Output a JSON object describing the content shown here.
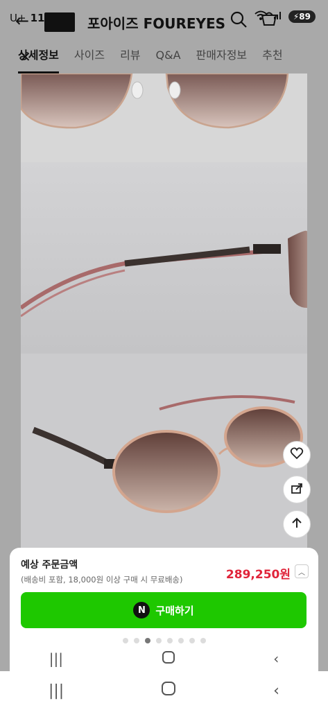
{
  "status_bar": {
    "carrier": "U+",
    "time": "11:42",
    "battery": "89"
  },
  "header": {
    "brand_title": "포아이즈 FOUREYES"
  },
  "tabs": [
    {
      "label": "상세정보",
      "active": true
    },
    {
      "label": "사이즈",
      "active": false
    },
    {
      "label": "리뷰",
      "active": false
    },
    {
      "label": "Q&A",
      "active": false
    },
    {
      "label": "판매자정보",
      "active": false
    },
    {
      "label": "추천",
      "active": false
    }
  ],
  "order_sheet": {
    "title": "예상 주문금액",
    "subtitle": "(배송비 포함, 18,000원 이상 구매 시 무료배송)",
    "price": "289,250원",
    "buy_button": "구매하기",
    "buy_icon_letter": "N"
  },
  "icons": [
    "back-icon",
    "search-icon",
    "cart-icon",
    "close-icon",
    "heart-icon",
    "share-icon",
    "arrow-up-icon",
    "recent-apps-icon",
    "home-icon",
    "back-nav-icon"
  ],
  "colors": {
    "price": "#e0243a",
    "buy_button": "#1ec800",
    "active_tab_underline": "#111111"
  },
  "carousel": {
    "dot_count": 8,
    "active_index": 2
  }
}
